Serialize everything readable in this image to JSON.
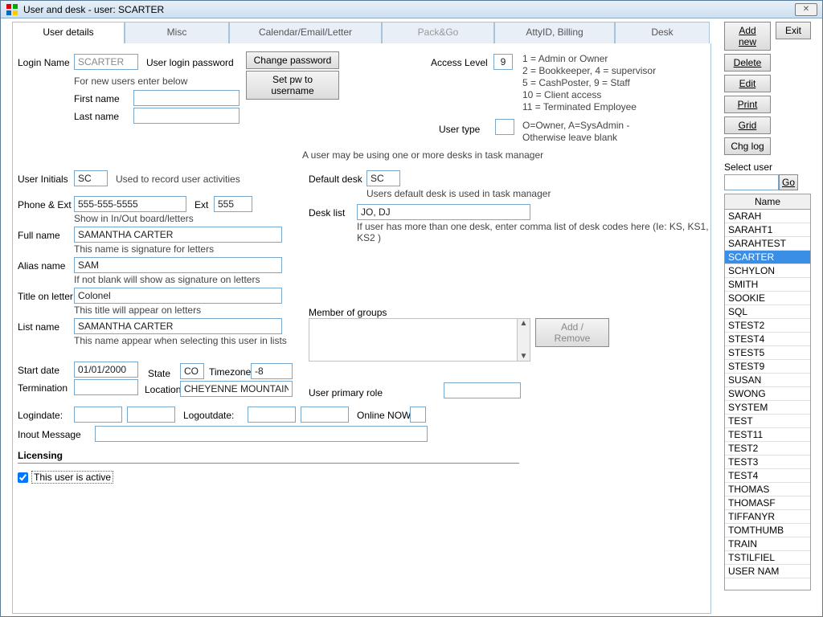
{
  "window": {
    "title": "User and desk - user: SCARTER",
    "close": "✕"
  },
  "tabs": {
    "t0": "User details",
    "t1": "Misc",
    "t2": "Calendar/Email/Letter",
    "t3": "Pack&Go",
    "t4": "AttyID, Billing",
    "t5": "Desk"
  },
  "sidebar": {
    "add": "Add new",
    "delete": "Delete",
    "edit": "Edit",
    "print": "Print",
    "grid": "Grid",
    "chglog": "Chg log",
    "exit": "Exit",
    "selectuser": "Select user",
    "go": "Go",
    "name_hdr": "Name",
    "users": [
      "SARAH",
      "SARAHT1",
      "SARAHTEST",
      "SCARTER",
      "SCHYLON",
      "SMITH",
      "SOOKIE",
      "SQL",
      "STEST2",
      "STEST4",
      "STEST5",
      "STEST9",
      "SUSAN",
      "SWONG",
      "SYSTEM",
      "TEST",
      "TEST11",
      "TEST2",
      "TEST3",
      "TEST4",
      "THOMAS",
      "THOMASF",
      "TIFFANYR",
      "TOMTHUMB",
      "TRAIN",
      "TSTILFIEL",
      "USER NAM"
    ],
    "selected_index": 3
  },
  "login": {
    "loginname_lbl": "Login Name",
    "loginname": "SCARTER",
    "userloginpw_lbl": "User login password",
    "changepw": "Change password",
    "setpw": "Set pw to username",
    "newusers_note": "For new users enter below",
    "firstname_lbl": "First name",
    "lastname_lbl": "Last name",
    "firstname": "",
    "lastname": ""
  },
  "access": {
    "level_lbl": "Access Level",
    "level": "9",
    "l1": "1 = Admin or Owner",
    "l2": "2 = Bookkeeper, 4 = supervisor",
    "l3": "5 = CashPoster, 9 = Staff",
    "l4": "10 = Client access",
    "l5": "11 = Terminated Employee",
    "usertype_lbl": "User type",
    "usertype": "",
    "usertype_note1": "O=Owner, A=SysAdmin -",
    "usertype_note2": "Otherwise leave blank"
  },
  "midnote": "A user may be using one or more desks in task manager",
  "details": {
    "initials_lbl": "User Initials",
    "initials": "SC",
    "initials_note": "Used to record user activities",
    "defaultdesk_lbl": "Default desk",
    "defaultdesk": "SC",
    "defaultdesk_note": "Users default desk is used in task manager",
    "phone_lbl": "Phone & Ext",
    "phone": "555-555-5555",
    "ext_lbl": "Ext",
    "ext": "555",
    "phone_note": "Show in In/Out board/letters",
    "desklist_lbl": "Desk list",
    "desklist": "JO, DJ",
    "desklist_note": "If user has more than one desk, enter comma list of desk codes here (Ie:  KS, KS1, KS2 )",
    "fullname_lbl": "Full name",
    "fullname": "SAMANTHA CARTER",
    "fullname_note": "This name is signature for letters",
    "alias_lbl": "Alias name",
    "alias": "SAM",
    "alias_note": "If not blank will show as signature on letters",
    "title_lbl": "Title on letter",
    "title": "Colonel",
    "title_note": "This title will  appear on letters",
    "listname_lbl": "List name",
    "listname": "SAMANTHA CARTER",
    "listname_note": "This name appear when selecting this user in lists",
    "groups_lbl": "Member of groups",
    "addremove": "Add / Remove",
    "startdate_lbl": "Start date",
    "startdate": "01/01/2000",
    "state_lbl": "State",
    "state": "CO",
    "timezone_lbl": "Timezone",
    "timezone": "-8",
    "termination_lbl": "Termination",
    "termination": "",
    "location_lbl": "Location",
    "location": "CHEYENNE MOUNTAIN",
    "primaryrole_lbl": "User primary role",
    "primaryrole": "",
    "logindate_lbl": "Logindate:",
    "logindate1": "",
    "logindate2": "",
    "logoutdate_lbl": "Logoutdate:",
    "logoutdate1": "",
    "logoutdate2": "",
    "onlinenow_lbl": "Online NOW",
    "onlinenow": "",
    "inoutmsg_lbl": "Inout Message",
    "inoutmsg": ""
  },
  "licensing": {
    "hdr": "Licensing",
    "active_lbl": "This user is active"
  }
}
